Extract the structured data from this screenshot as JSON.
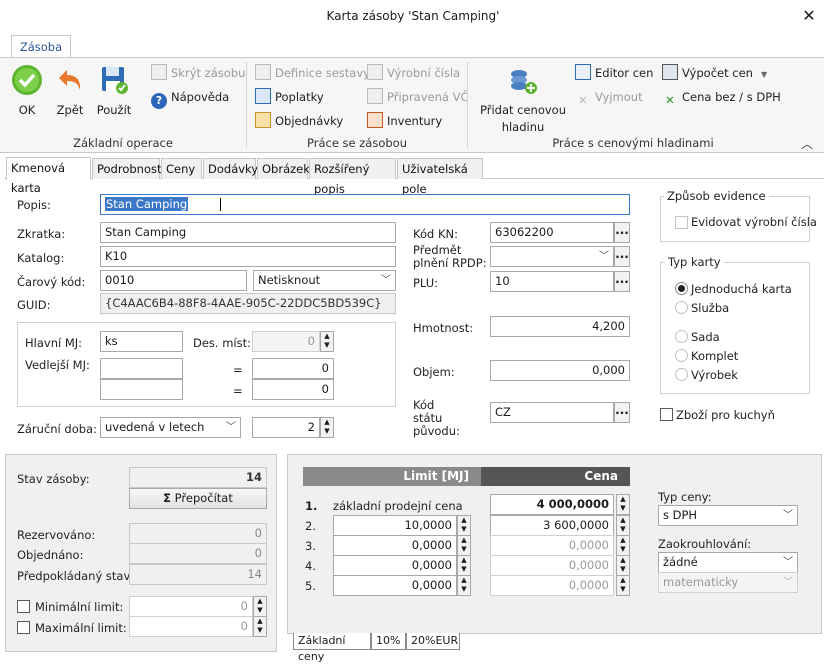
{
  "window": {
    "title": "Karta zásoby 'Stan Camping'",
    "close_icon": "close-icon"
  },
  "ribbon": {
    "tab": "Zásoba",
    "groups": {
      "basic": "Základní operace",
      "work": "Práce se zásobou",
      "price": "Práce s cenovými hladinami"
    },
    "ok": "OK",
    "back": "Zpět",
    "apply": "Použít",
    "hide": "Skrýt zásobu",
    "help": "Nápověda",
    "sets": "Definice sestavy",
    "fees": "Poplatky",
    "orders": "Objednávky",
    "serial": "Výrobní čísla",
    "vat": "Připravená VČ",
    "inventory": "Inventury",
    "add_level_1": "Přidat cenovou",
    "add_level_2": "hladinu",
    "price_editor": "Editor cen",
    "remove": "Vyjmout",
    "calc_price": "Výpočet cen",
    "price_toggle": "Cena bez / s DPH"
  },
  "tabs": [
    "Kmenová karta",
    "Podrobnosti",
    "Ceny",
    "Dodávky",
    "Obrázek",
    "Rozšířený popis",
    "Uživatelská pole"
  ],
  "form": {
    "popis_label": "Popis:",
    "popis_value": "Stan Camping",
    "zkratka_label": "Zkratka:",
    "zkratka_value": "Stan Camping",
    "katalog_label": "Katalog:",
    "katalog_value": "K10",
    "carovy_label": "Čarový kód:",
    "carovy_value": "0010",
    "carovy_select": "Netisknout",
    "guid_label": "GUID:",
    "guid_value": "{C4AAC6B4-88F8-4AAE-905C-22DDC5BD539C}",
    "hlavni_mj_label": "Hlavní MJ:",
    "hlavni_mj_value": "ks",
    "des_mist_label": "Des. míst:",
    "des_mist_value": "0",
    "vedlejsi_mj_label": "Vedlejší MJ:",
    "vedlejsi_1": "0",
    "vedlejsi_2": "0",
    "eq": "=",
    "zarucni_label": "Záruční doba:",
    "zarucni_select": "uvedená v letech",
    "zarucni_value": "2",
    "kod_kn_label": "Kód KN:",
    "kod_kn_value": "63062200",
    "rpdp_label_1": "Předmět",
    "rpdp_label_2": "plnění RPDP:",
    "plu_label": "PLU:",
    "plu_value": "10",
    "hmotnost_label": "Hmotnost:",
    "hmotnost_value": "4,200",
    "objem_label": "Objem:",
    "objem_value": "0,000",
    "kod_statu_1": "Kód",
    "kod_statu_2": "státu",
    "kod_statu_3": "původu:",
    "kod_statu_value": "CZ"
  },
  "evidence": {
    "title": "Způsob evidence",
    "serial": "Evidovat výrobní čísla"
  },
  "card_type": {
    "title": "Typ karty",
    "options": [
      "Jednoduchá karta",
      "Služba",
      "Sada",
      "Komplet",
      "Výrobek"
    ],
    "selected": "Jednoduchá karta"
  },
  "kitchen": "Zboží pro kuchyň",
  "stock": {
    "stav_label": "Stav zásoby:",
    "stav_value": "14",
    "recalc": "Přepočítat",
    "sigma": "Σ",
    "rezerv_label": "Rezervováno:",
    "rezerv_value": "0",
    "objed_label": "Objednáno:",
    "objed_value": "0",
    "predp_label": "Předpokládaný stav:",
    "predp_value": "14",
    "min_label": "Minimální limit:",
    "min_value": "0",
    "max_label": "Maximální limit:",
    "max_value": "0"
  },
  "prices": {
    "col_limit": "Limit [MJ]",
    "col_price": "Cena",
    "rows": [
      {
        "n": "1.",
        "limit": "základní prodejní cena",
        "price": "4 000,0000"
      },
      {
        "n": "2.",
        "limit": "10,0000",
        "price": "3 600,0000"
      },
      {
        "n": "3.",
        "limit": "0,0000",
        "price": "0,0000"
      },
      {
        "n": "4.",
        "limit": "0,0000",
        "price": "0,0000"
      },
      {
        "n": "5.",
        "limit": "0,0000",
        "price": "0,0000"
      }
    ],
    "typ_label": "Typ ceny:",
    "typ_value": "s DPH",
    "round_label": "Zaokrouhlování:",
    "round_value": "žádné",
    "round_mode": "matematicky",
    "bottom_tabs": [
      "Základní ceny",
      "10%",
      "20%EUR"
    ]
  }
}
